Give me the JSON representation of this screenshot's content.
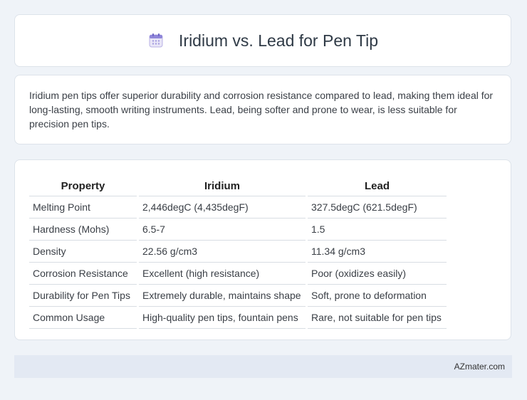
{
  "header": {
    "icon": "calendar-icon",
    "title": "Iridium vs. Lead for Pen Tip"
  },
  "summary": {
    "text": "Iridium pen tips offer superior durability and corrosion resistance compared to lead, making them ideal for long-lasting, smooth writing instruments. Lead, being softer and prone to wear, is less suitable for precision pen tips."
  },
  "table": {
    "headers": [
      "Property",
      "Iridium",
      "Lead"
    ],
    "rows": [
      [
        "Melting Point",
        "2,446degC (4,435degF)",
        "327.5degC (621.5degF)"
      ],
      [
        "Hardness (Mohs)",
        "6.5-7",
        "1.5"
      ],
      [
        "Density",
        "22.56 g/cm3",
        "11.34 g/cm3"
      ],
      [
        "Corrosion Resistance",
        "Excellent (high resistance)",
        "Poor (oxidizes easily)"
      ],
      [
        "Durability for Pen Tips",
        "Extremely durable, maintains shape",
        "Soft, prone to deformation"
      ],
      [
        "Common Usage",
        "High-quality pen tips, fountain pens",
        "Rare, not suitable for pen tips"
      ]
    ]
  },
  "footer": {
    "site": "AZmater.com"
  },
  "colors": {
    "background": "#eff3f8",
    "card": "#ffffff",
    "footer_bg": "#e3e9f3"
  }
}
